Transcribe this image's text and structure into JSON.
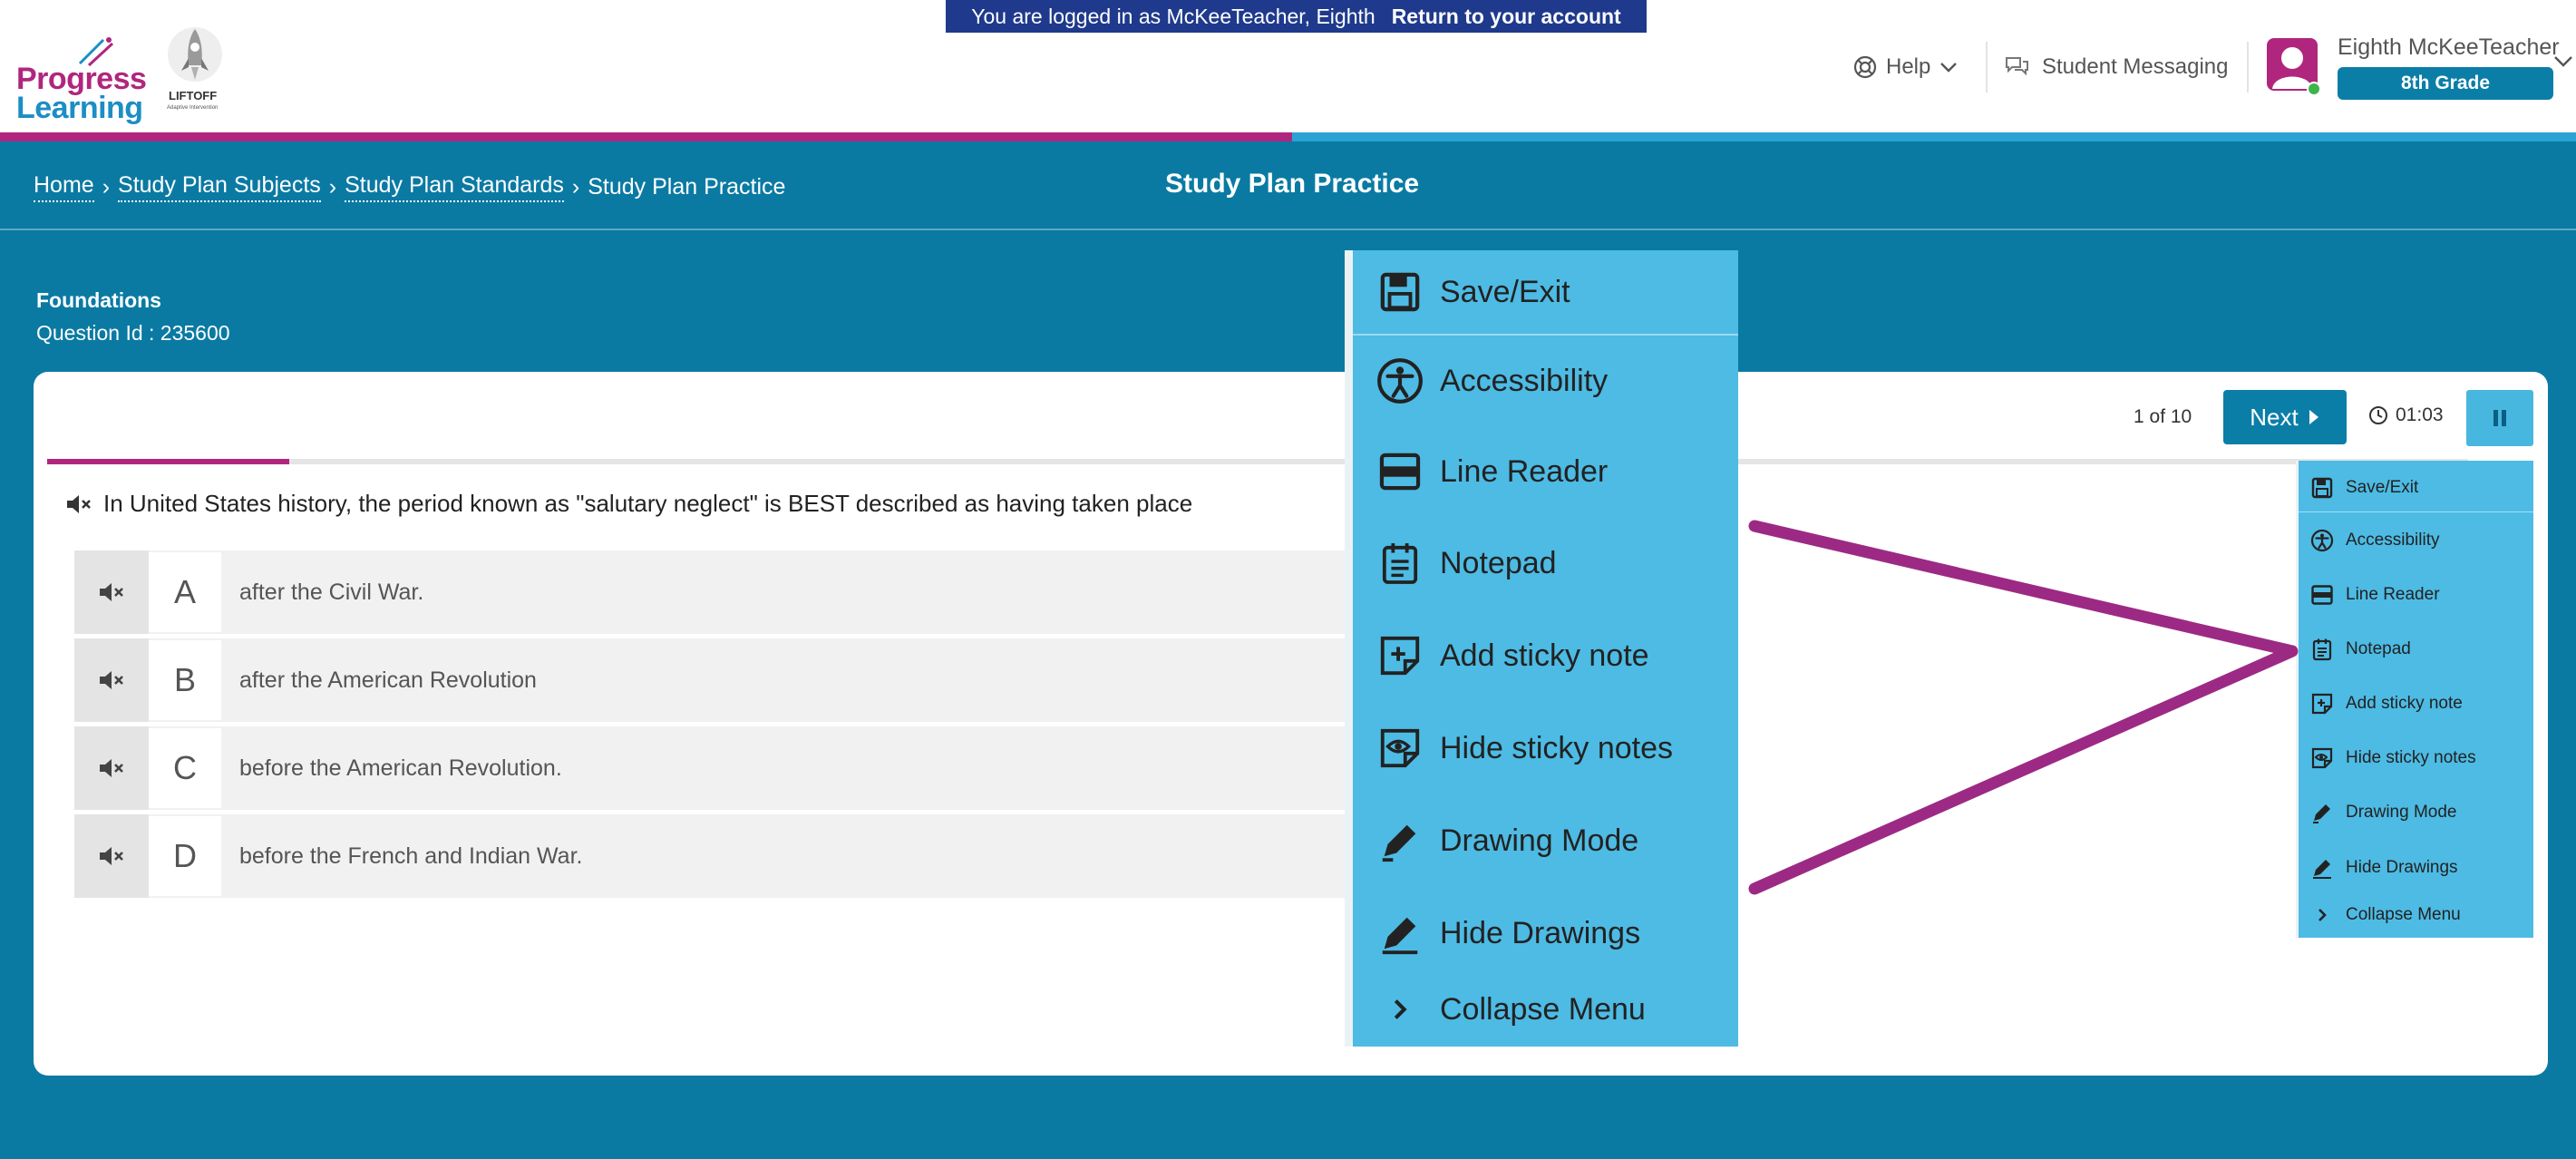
{
  "banner": {
    "logged_in_text": "You are logged in as McKeeTeacher, Eighth",
    "return_label": "Return to your account"
  },
  "logo": {
    "line1": "Progress",
    "line2": "Learning"
  },
  "liftoff": {
    "title": "LIFTOFF",
    "subtitle": "Adaptive Intervention"
  },
  "header": {
    "help_label": "Help",
    "messaging_label": "Student Messaging",
    "user_name": "Eighth McKeeTeacher",
    "grade_label": "8th Grade"
  },
  "breadcrumb": {
    "items": [
      "Home",
      "Study Plan Subjects",
      "Study Plan Standards"
    ],
    "current": "Study Plan Practice",
    "separator": "›"
  },
  "page_title": "Study Plan Practice",
  "subject": "Foundations",
  "question_id": "Question Id : 235600",
  "controls": {
    "count": "1 of 10",
    "next_label": "Next",
    "timer": "01:03",
    "progress_fraction": 0.1
  },
  "question": {
    "text": "In United States history, the period known as \"salutary neglect\" is BEST described as having taken place",
    "answers": [
      {
        "letter": "A",
        "text": "after the Civil War."
      },
      {
        "letter": "B",
        "text": "after the American Revolution"
      },
      {
        "letter": "C",
        "text": "before the American Revolution."
      },
      {
        "letter": "D",
        "text": "before the French and Indian War."
      }
    ]
  },
  "menu": {
    "items": [
      {
        "label": "Save/Exit",
        "icon": "save-icon"
      },
      {
        "label": "Accessibility",
        "icon": "accessibility-icon"
      },
      {
        "label": "Line Reader",
        "icon": "line-reader-icon"
      },
      {
        "label": "Notepad",
        "icon": "notepad-icon"
      },
      {
        "label": "Add sticky note",
        "icon": "add-sticky-note-icon"
      },
      {
        "label": "Hide sticky notes",
        "icon": "hide-sticky-notes-icon"
      },
      {
        "label": "Drawing Mode",
        "icon": "pencil-icon"
      },
      {
        "label": "Hide Drawings",
        "icon": "hide-drawings-icon"
      },
      {
        "label": "Collapse Menu",
        "icon": "chevron-right-icon"
      }
    ]
  },
  "colors": {
    "brand_teal": "#0a7aa3",
    "brand_pink": "#b0267e",
    "menu_blue": "#4dbbe4",
    "banner_navy": "#1f3a8c",
    "annotation": "#9c2a84"
  }
}
